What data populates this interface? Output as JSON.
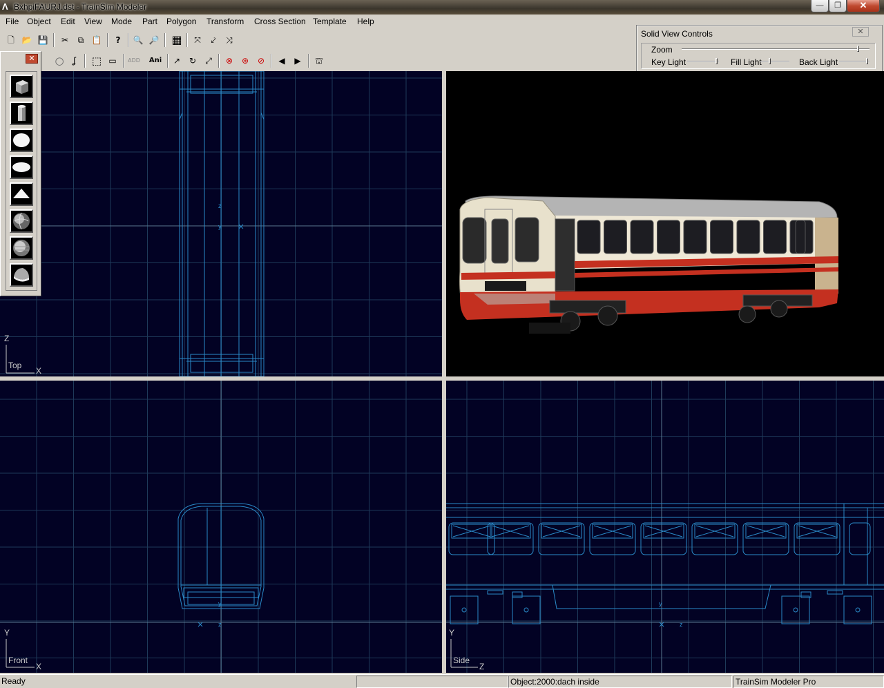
{
  "window": {
    "title": "BxhpiFAURJ.dst - TrainSim Modeler",
    "min_symbol": "—",
    "max_symbol": "❐",
    "close_symbol": "✕"
  },
  "menu": [
    "File",
    "Object",
    "Edit",
    "View",
    "Mode",
    "Part",
    "Polygon",
    "Transform",
    "Cross Section",
    "Template",
    "Help"
  ],
  "toolbar": {
    "ani_label": "Ani",
    "add_label": "ADD"
  },
  "solid_view_controls": {
    "title": "Solid View Controls",
    "close_symbol": "✕",
    "zoom_label": "Zoom",
    "key_light_label": "Key Light",
    "fill_light_label": "Fill Light",
    "back_light_label": "Back Light",
    "zoom_level": 0.95,
    "key_light_level": 1.0,
    "fill_light_level": 0.35,
    "back_light_level": 1.0
  },
  "viewports": {
    "top": {
      "label": "Top",
      "axis_v": "Z",
      "axis_h": "X"
    },
    "front": {
      "label": "Front",
      "axis_v": "Y",
      "axis_h": "X"
    },
    "side": {
      "label": "Side",
      "axis_v": "Y",
      "axis_h": "Z"
    }
  },
  "palette": {
    "close_symbol": "✕",
    "tools": [
      "cube-icon",
      "cylinder-icon",
      "sphere-icon",
      "ellipsoid-icon",
      "cone-icon",
      "textured-sphere-icon",
      "textured-globe-icon",
      "hemisphere-icon"
    ]
  },
  "statusbar": {
    "status": "Ready",
    "object": "Object:2000:dach inside",
    "product": "TrainSim Modeler Pro"
  },
  "colors": {
    "viewport_bg": "#020224",
    "grid": "#1e3a5a",
    "wire": "#2a8ac8",
    "accent_red": "#c43020"
  }
}
